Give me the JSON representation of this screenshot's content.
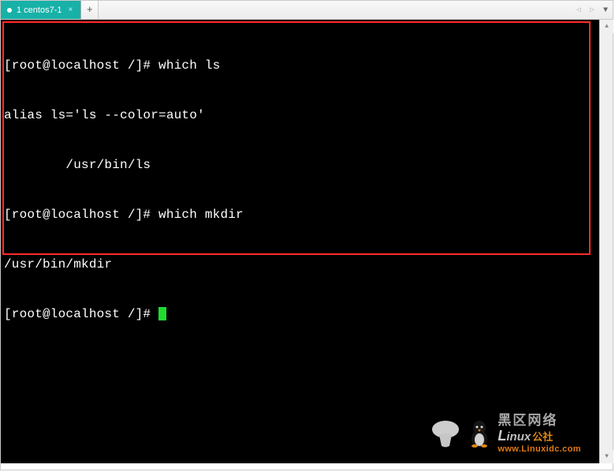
{
  "tabbar": {
    "active_tab": {
      "label": "1 centos7-1",
      "indicator": "dot",
      "close_glyph": "×"
    },
    "new_tab_glyph": "+",
    "nav_left_glyph": "◁",
    "nav_right_glyph": "▷",
    "menu_glyph": "▼"
  },
  "terminal": {
    "lines": [
      "[root@localhost /]# which ls",
      "alias ls='ls --color=auto'",
      "        /usr/bin/ls",
      "[root@localhost /]# which mkdir",
      "/usr/bin/mkdir",
      "[root@localhost /]# "
    ],
    "prompt_cursor": true
  },
  "scrollbar": {
    "up_glyph": "▲",
    "down_glyph": "▼"
  },
  "watermark": {
    "cn_text": "黑区网络",
    "brand_l": "L",
    "brand_rest": "inux",
    "brand_suffix": "公社",
    "url": "www.Linuxidc.com"
  },
  "colors": {
    "tab_active_bg": "#17b1a8",
    "highlight_border": "#ff2a2a",
    "cursor": "#1fdb2e",
    "watermark_orange": "#ff8a1a"
  }
}
